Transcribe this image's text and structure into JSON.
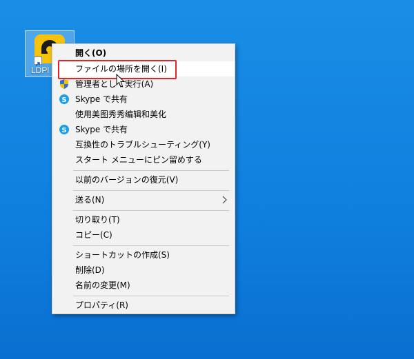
{
  "desktop": {
    "icon_label": "LDPl"
  },
  "colors": {
    "highlight": "#e0242a",
    "logo": "#f6c20a",
    "skype": "#1aa0e8"
  },
  "menu": {
    "items": [
      {
        "label": "開く(O)",
        "bold": true
      },
      {
        "label": "ファイルの場所を開く(I)",
        "hover": true
      },
      {
        "label": "管理者として実行(A)",
        "icon": "uac-shield-icon"
      },
      {
        "label": "Skype で共有",
        "icon": "skype-icon"
      },
      {
        "label": "使用美图秀秀编辑和美化"
      },
      {
        "label": "Skype で共有",
        "icon": "skype-icon"
      },
      {
        "label": "互換性のトラブルシューティング(Y)"
      },
      {
        "label": "スタート メニューにピン留めする"
      },
      {
        "label": "以前のバージョンの復元(V)"
      },
      {
        "label": "送る(N)",
        "submenu": true
      },
      {
        "label": "切り取り(T)"
      },
      {
        "label": "コピー(C)"
      },
      {
        "label": "ショートカットの作成(S)"
      },
      {
        "label": "削除(D)"
      },
      {
        "label": "名前の変更(M)"
      },
      {
        "label": "プロパティ(R)"
      }
    ]
  }
}
